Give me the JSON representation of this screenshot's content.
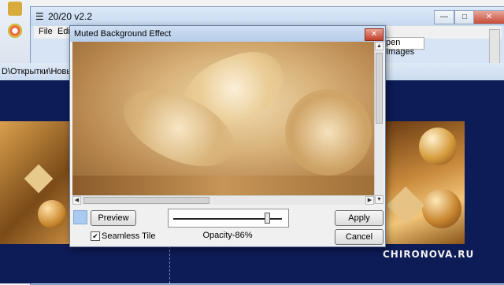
{
  "main_window": {
    "title": "20/20 v2.2",
    "menu": [
      "File",
      "Edit"
    ],
    "tab_fragment": "pen Images",
    "caption_buttons": {
      "minimize": "—",
      "maximize": "□",
      "close": "✕"
    }
  },
  "second_window": {
    "path_fragment": "D\\Открытки\\Новый го"
  },
  "dialog": {
    "title": "Muted Background Effect",
    "close_icon": "✕",
    "preview_button": "Preview",
    "apply_button": "Apply",
    "cancel_button": "Cancel",
    "seamless_label": "Seamless Tile",
    "seamless_checked": true,
    "opacity_label": "Opacity-86%",
    "opacity_value": 0.86,
    "swatch_color": "#a9cbf2"
  },
  "watermark": "CHIRONOVA.RU",
  "colors": {
    "canvas_bg": "#0d1b57",
    "accent": "#c74b36"
  }
}
